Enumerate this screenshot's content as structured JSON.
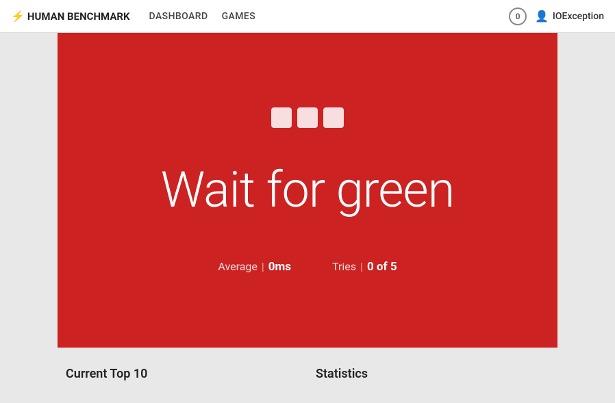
{
  "nav": {
    "bolt": "⚡",
    "brand": "HUMAN BENCHMARK",
    "links": [
      "DASHBOARD",
      "GAMES"
    ],
    "badge_count": "0",
    "username": "IOException"
  },
  "game": {
    "dots_count": 3,
    "title": "Wait for green",
    "stats": {
      "average_label": "Average",
      "average_value": "0ms",
      "tries_label": "Tries",
      "tries_value": "0 of 5"
    }
  },
  "bottom": {
    "left_heading": "Current Top 10",
    "right_heading": "Statistics"
  }
}
